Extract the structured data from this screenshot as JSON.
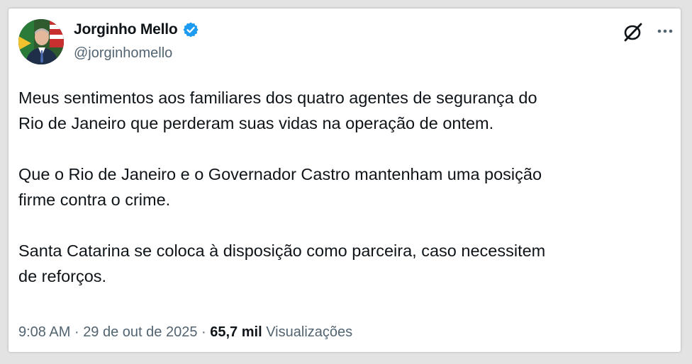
{
  "tweet": {
    "author": {
      "display_name": "Jorginho Mello",
      "handle": "@jorginhomello",
      "verified": true
    },
    "paragraphs": [
      "Meus sentimentos aos familiares dos quatro agentes de segurança do\nRio de Janeiro que perderam suas vidas na operação de ontem.",
      "Que o Rio de Janeiro e o Governador Castro mantenham uma posição\nfirme contra o crime.",
      "Santa Catarina se coloca à disposição como parceira, caso necessitem\nde reforços."
    ],
    "time": "9:08 AM",
    "date": "29 de out de 2025",
    "separator": "·",
    "views_count": "65,7 mil",
    "views_label": "Visualizações"
  },
  "icons": {
    "verified": "verified-badge-icon",
    "logo": "x-logo-icon",
    "more": "more-horizontal-icon"
  },
  "colors": {
    "verified_blue": "#1d9bf0",
    "text_primary": "#0f1419",
    "text_secondary": "#536471"
  }
}
